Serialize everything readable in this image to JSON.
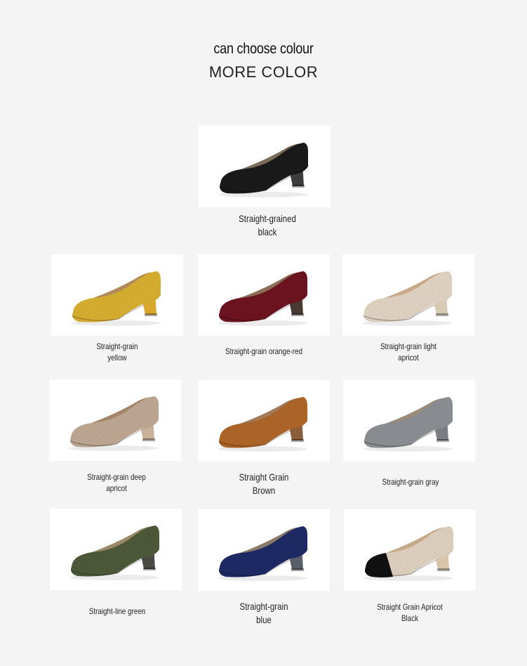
{
  "header": {
    "subtitle": "can choose colour",
    "title": "MORE COLOR"
  },
  "products": [
    {
      "label": "Straight-grained\nblack",
      "upper": "#1a1a1a",
      "heel": "#3d3d3d",
      "lining": "#7a6a58",
      "toe": ""
    },
    {
      "label": "Straight-grain\nyellow",
      "upper": "#d9b030",
      "heel": "#d9a82a",
      "lining": "#b08a5a",
      "toe": ""
    },
    {
      "label": "Straight-grain orange-red",
      "upper": "#6e1420",
      "heel": "#4a3a34",
      "lining": "#8a6e58",
      "toe": ""
    },
    {
      "label": "Straight-grain light\napricot",
      "upper": "#e2d5c4",
      "heel": "#d8c9b4",
      "lining": "#c8a98a",
      "toe": ""
    },
    {
      "label": "Straight-grain deep\napricot",
      "upper": "#bfa994",
      "heel": "#c8b09a",
      "lining": "#a3866a",
      "toe": ""
    },
    {
      "label": "Straight Grain\nBrown",
      "upper": "#b06628",
      "heel": "#8a5e3a",
      "lining": "#a07a58",
      "toe": ""
    },
    {
      "label": "Straight-grain gray",
      "upper": "#8c9094",
      "heel": "#7a7e82",
      "lining": "#9a8a78",
      "toe": ""
    },
    {
      "label": "Straight-line green",
      "upper": "#4e5a3a",
      "heel": "#4a4a44",
      "lining": "#9a8868",
      "toe": ""
    },
    {
      "label": "Straight-grain\nblue",
      "upper": "#1e2a66",
      "heel": "#5a5e6a",
      "lining": "#8a7a68",
      "toe": ""
    },
    {
      "label": "Straight Grain Apricot\nBlack",
      "upper": "#e0d2c0",
      "heel": "#d8c4a8",
      "lining": "#c4a888",
      "toe": "#111111"
    }
  ]
}
